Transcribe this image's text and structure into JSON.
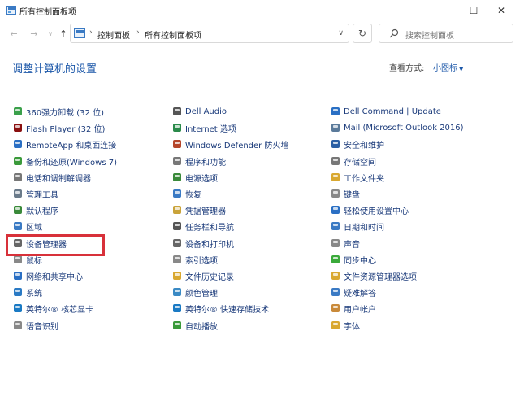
{
  "window": {
    "title": "所有控制面板项",
    "minimize": "—",
    "maximize": "☐",
    "close": "✕"
  },
  "nav": {
    "back": "←",
    "forward": "→",
    "dropdown": "∨",
    "up": "↑",
    "refresh": "↻",
    "breadcrumb": [
      "控制面板",
      "所有控制面板项"
    ],
    "search_placeholder": "搜索控制面板"
  },
  "heading": "调整计算机的设置",
  "view_by": {
    "label": "查看方式:",
    "value": "小图标"
  },
  "columns": [
    [
      {
        "label": "360强力卸载 (32 位)",
        "icon": "uninstall-icon",
        "color": "#3aa04a"
      },
      {
        "label": "Flash Player (32 位)",
        "icon": "flash-icon",
        "color": "#8a1010"
      },
      {
        "label": "RemoteApp 和桌面连接",
        "icon": "remote-icon",
        "color": "#2a6fc4"
      },
      {
        "label": "备份和还原(Windows 7)",
        "icon": "backup-icon",
        "color": "#3a9a3a"
      },
      {
        "label": "电话和调制解调器",
        "icon": "phone-icon",
        "color": "#777777"
      },
      {
        "label": "管理工具",
        "icon": "tools-icon",
        "color": "#6a7a8a"
      },
      {
        "label": "默认程序",
        "icon": "default-programs-icon",
        "color": "#3a8a3a"
      },
      {
        "label": "区域",
        "icon": "region-icon",
        "color": "#3a7ac4"
      },
      {
        "label": "设备管理器",
        "icon": "device-manager-icon",
        "color": "#666666"
      },
      {
        "label": "鼠标",
        "icon": "mouse-icon",
        "color": "#888888"
      },
      {
        "label": "网络和共享中心",
        "icon": "network-icon",
        "color": "#2a6fc4"
      },
      {
        "label": "系统",
        "icon": "system-icon",
        "color": "#2a7ac4"
      },
      {
        "label": "英特尔® 核芯显卡",
        "icon": "intel-graphics-icon",
        "color": "#1a7ac4"
      },
      {
        "label": "语音识别",
        "icon": "microphone-icon",
        "color": "#888888"
      }
    ],
    [
      {
        "label": "Dell Audio",
        "icon": "audio-icon",
        "color": "#555555"
      },
      {
        "label": "Internet 选项",
        "icon": "internet-icon",
        "color": "#2a8a4a"
      },
      {
        "label": "Windows Defender 防火墙",
        "icon": "firewall-icon",
        "color": "#b5452a"
      },
      {
        "label": "程序和功能",
        "icon": "programs-icon",
        "color": "#777777"
      },
      {
        "label": "电源选项",
        "icon": "power-icon",
        "color": "#3a8a3a"
      },
      {
        "label": "恢复",
        "icon": "recovery-icon",
        "color": "#3a7ac4"
      },
      {
        "label": "凭据管理器",
        "icon": "credential-icon",
        "color": "#c9a33a"
      },
      {
        "label": "任务栏和导航",
        "icon": "taskbar-icon",
        "color": "#555555"
      },
      {
        "label": "设备和打印机",
        "icon": "printer-icon",
        "color": "#666666"
      },
      {
        "label": "索引选项",
        "icon": "index-icon",
        "color": "#888888"
      },
      {
        "label": "文件历史记录",
        "icon": "file-history-icon",
        "color": "#d9a830"
      },
      {
        "label": "颜色管理",
        "icon": "color-icon",
        "color": "#3a8ac4"
      },
      {
        "label": "英特尔® 快速存储技术",
        "icon": "intel-storage-icon",
        "color": "#1a7ac4"
      },
      {
        "label": "自动播放",
        "icon": "autoplay-icon",
        "color": "#3a9a3a"
      }
    ],
    [
      {
        "label": "Dell Command | Update",
        "icon": "dell-update-icon",
        "color": "#2a6fc4"
      },
      {
        "label": "Mail (Microsoft Outlook 2016)",
        "icon": "mail-icon",
        "color": "#5a7a9a"
      },
      {
        "label": "安全和维护",
        "icon": "security-flag-icon",
        "color": "#2a5fa4"
      },
      {
        "label": "存储空间",
        "icon": "storage-icon",
        "color": "#777777"
      },
      {
        "label": "工作文件夹",
        "icon": "work-folders-icon",
        "color": "#d9a830"
      },
      {
        "label": "键盘",
        "icon": "keyboard-icon",
        "color": "#888888"
      },
      {
        "label": "轻松使用设置中心",
        "icon": "ease-of-access-icon",
        "color": "#2a6fc4"
      },
      {
        "label": "日期和时间",
        "icon": "clock-icon",
        "color": "#3a7ac4"
      },
      {
        "label": "声音",
        "icon": "sound-icon",
        "color": "#888888"
      },
      {
        "label": "同步中心",
        "icon": "sync-icon",
        "color": "#3aaa3a"
      },
      {
        "label": "文件资源管理器选项",
        "icon": "folder-options-icon",
        "color": "#d9a830"
      },
      {
        "label": "疑难解答",
        "icon": "troubleshoot-icon",
        "color": "#3a7ac4"
      },
      {
        "label": "用户帐户",
        "icon": "user-accounts-icon",
        "color": "#c98a3a"
      },
      {
        "label": "字体",
        "icon": "fonts-icon",
        "color": "#d9a830"
      }
    ]
  ]
}
